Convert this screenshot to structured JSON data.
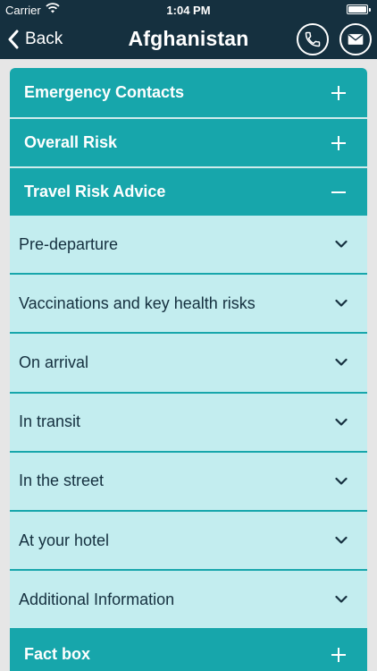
{
  "status_bar": {
    "carrier": "Carrier",
    "time": "1:04 PM"
  },
  "nav": {
    "back_label": "Back",
    "title": "Afghanistan",
    "call_icon": "phone-icon",
    "mail_icon": "mail-icon"
  },
  "sections": {
    "emergency": {
      "title": "Emergency Contacts",
      "state": "collapsed"
    },
    "overall": {
      "title": "Overall Risk",
      "state": "collapsed"
    },
    "travel": {
      "title": "Travel Risk Advice",
      "state": "expanded"
    },
    "fact": {
      "title": "Fact box",
      "state": "collapsed"
    }
  },
  "travel_items": [
    "Pre-departure",
    "Vaccinations and key health risks",
    "On arrival",
    "In transit",
    "In the street",
    "At your hotel",
    "Additional Information"
  ],
  "colors": {
    "nav_bg": "#15303f",
    "section_bg": "#17a6ab",
    "item_bg": "#c3edef",
    "item_text": "#15303f"
  }
}
